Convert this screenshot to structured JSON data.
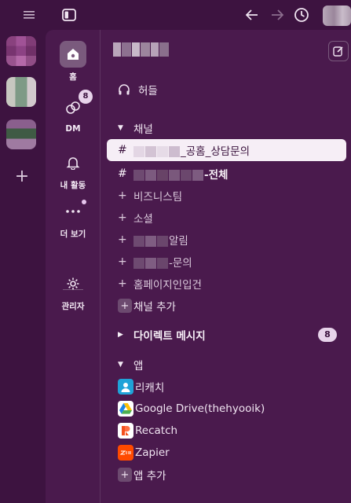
{
  "colors": {
    "sidebar_bg": "#3d1340",
    "panel_bg": "#4a1a4d",
    "selected_bg": "#f6eef6",
    "badge_bg": "#e7d3ea"
  },
  "rail": {
    "home_label": "홈",
    "dm_label": "DM",
    "dm_badge": "8",
    "activity_label": "내 활동",
    "more_label": "더 보기",
    "admin_label": "관리자"
  },
  "sidebar": {
    "huddle_label": "허들",
    "channels_header": "채널",
    "channels": [
      {
        "prefix": "#",
        "suffix": "_공홈_상담문의",
        "selected": true
      },
      {
        "prefix": "#",
        "suffix": "-전체",
        "selected": false
      },
      {
        "prefix": "+",
        "label": "비즈니스팀"
      },
      {
        "prefix": "+",
        "label": "소셜"
      },
      {
        "prefix": "+",
        "suffix": "알림"
      },
      {
        "prefix": "+",
        "suffix": "-문의"
      },
      {
        "prefix": "+",
        "label": "홈페이지인입건"
      }
    ],
    "add_channel_label": "채널 추가",
    "dm_header": "다이렉트 메시지",
    "dm_count": "8",
    "apps_header": "앱",
    "apps": [
      {
        "label": "리캐치",
        "icon": "person-icon"
      },
      {
        "label": "Google Drive(thehyooik)",
        "icon": "google-drive-icon"
      },
      {
        "label": "Recatch",
        "icon": "recatch-icon"
      },
      {
        "label": "Zapier",
        "icon": "zapier-icon"
      }
    ],
    "add_app_label": "앱 추가"
  }
}
